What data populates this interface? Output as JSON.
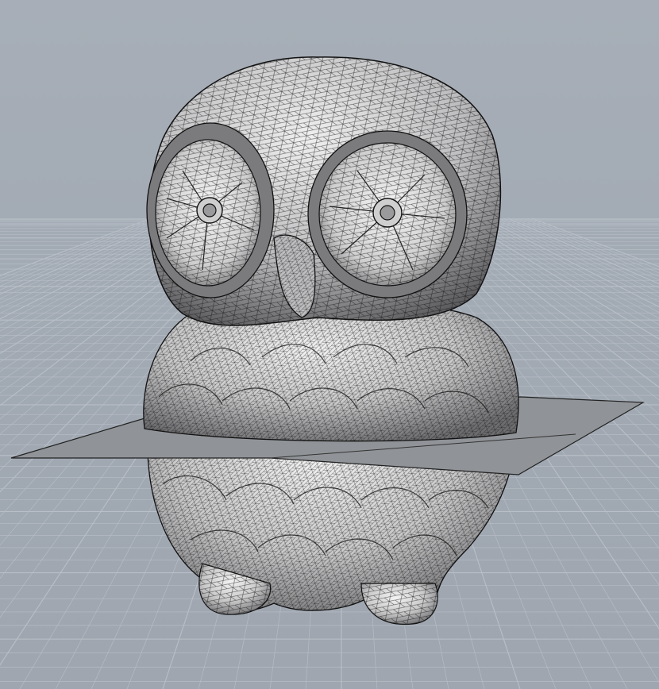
{
  "viewport": {
    "background_color": "#a5adb6",
    "grid_line_color": "#b9bfc7",
    "show_grid": true
  },
  "model": {
    "render_style": "wireframe mesh",
    "surface_color": "#d8d9db",
    "wire_color": "#111111"
  },
  "section_plane": {
    "color": "#8f9296",
    "edge_color": "#222222"
  }
}
